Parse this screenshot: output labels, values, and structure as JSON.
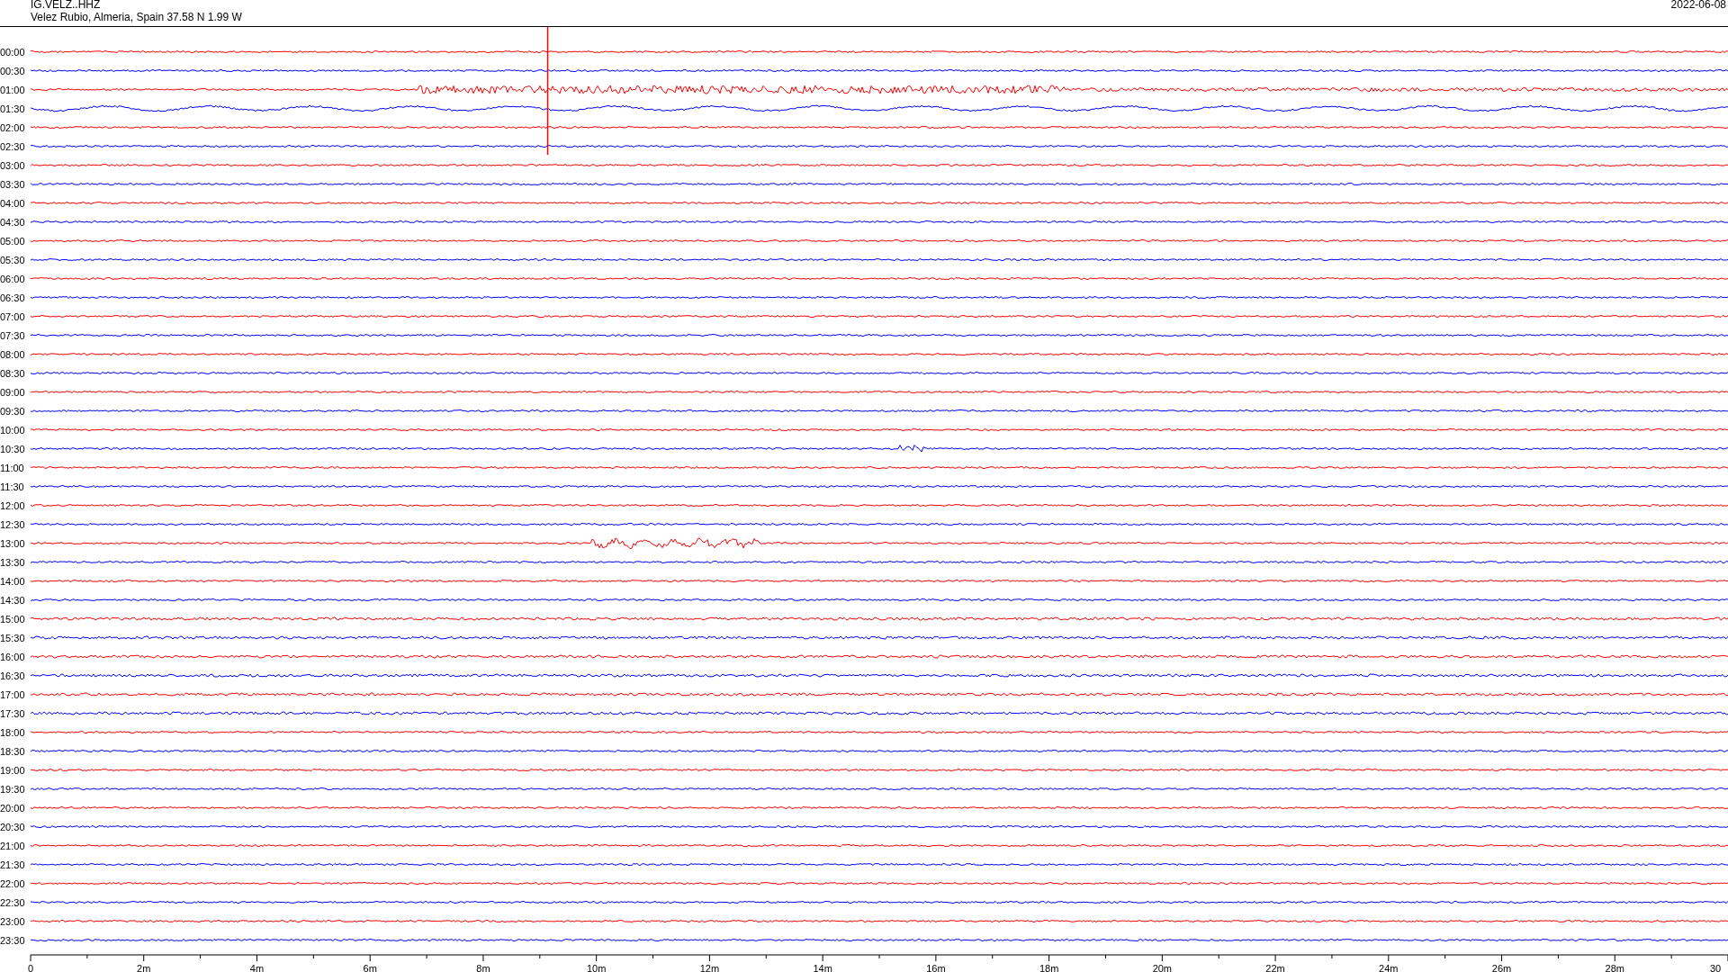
{
  "header": {
    "station": "IG.VELZ..HHZ",
    "location": "Velez Rubio, Almeria, Spain  37.58 N 1.99 W",
    "date": "2022-06-08"
  },
  "rows": [
    {
      "time": "00:00",
      "color": "#ff0000"
    },
    {
      "time": "00:30",
      "color": "#0000ff"
    },
    {
      "time": "01:00",
      "color": "#ff0000"
    },
    {
      "time": "01:30",
      "color": "#0000ff"
    },
    {
      "time": "02:00",
      "color": "#ff0000"
    },
    {
      "time": "02:30",
      "color": "#0000ff"
    },
    {
      "time": "03:00",
      "color": "#ff0000"
    },
    {
      "time": "03:30",
      "color": "#0000ff"
    },
    {
      "time": "04:00",
      "color": "#ff0000"
    },
    {
      "time": "04:30",
      "color": "#0000ff"
    },
    {
      "time": "05:00",
      "color": "#ff0000"
    },
    {
      "time": "05:30",
      "color": "#0000ff"
    },
    {
      "time": "06:00",
      "color": "#ff0000"
    },
    {
      "time": "06:30",
      "color": "#0000ff"
    },
    {
      "time": "07:00",
      "color": "#ff0000"
    },
    {
      "time": "07:30",
      "color": "#0000ff"
    },
    {
      "time": "08:00",
      "color": "#ff0000"
    },
    {
      "time": "08:30",
      "color": "#0000ff"
    },
    {
      "time": "09:00",
      "color": "#ff0000"
    },
    {
      "time": "09:30",
      "color": "#0000ff"
    },
    {
      "time": "10:00",
      "color": "#ff0000"
    },
    {
      "time": "10:30",
      "color": "#0000ff"
    },
    {
      "time": "11:00",
      "color": "#ff0000"
    },
    {
      "time": "11:30",
      "color": "#0000ff"
    },
    {
      "time": "12:00",
      "color": "#ff0000"
    },
    {
      "time": "12:30",
      "color": "#0000ff"
    },
    {
      "time": "13:00",
      "color": "#ff0000"
    },
    {
      "time": "13:30",
      "color": "#0000ff"
    },
    {
      "time": "14:00",
      "color": "#ff0000"
    },
    {
      "time": "14:30",
      "color": "#0000ff"
    },
    {
      "time": "15:00",
      "color": "#ff0000"
    },
    {
      "time": "15:30",
      "color": "#0000ff"
    },
    {
      "time": "16:00",
      "color": "#ff0000"
    },
    {
      "time": "16:30",
      "color": "#0000ff"
    },
    {
      "time": "17:00",
      "color": "#ff0000"
    },
    {
      "time": "17:30",
      "color": "#0000ff"
    },
    {
      "time": "18:00",
      "color": "#ff0000"
    },
    {
      "time": "18:30",
      "color": "#0000ff"
    },
    {
      "time": "19:00",
      "color": "#ff0000"
    },
    {
      "time": "19:30",
      "color": "#0000ff"
    },
    {
      "time": "20:00",
      "color": "#ff0000"
    },
    {
      "time": "20:30",
      "color": "#0000ff"
    },
    {
      "time": "21:00",
      "color": "#ff0000"
    },
    {
      "time": "21:30",
      "color": "#0000ff"
    },
    {
      "time": "22:00",
      "color": "#ff0000"
    },
    {
      "time": "22:30",
      "color": "#0000ff"
    },
    {
      "time": "23:00",
      "color": "#ff0000"
    },
    {
      "time": "23:30",
      "color": "#0000ff"
    }
  ],
  "time_axis": {
    "labels": [
      "0",
      "2m",
      "4m",
      "6m",
      "8m",
      "10m",
      "12m",
      "14m",
      "16m",
      "18m",
      "20m",
      "22m",
      "24m",
      "26m",
      "28m",
      "30"
    ]
  }
}
